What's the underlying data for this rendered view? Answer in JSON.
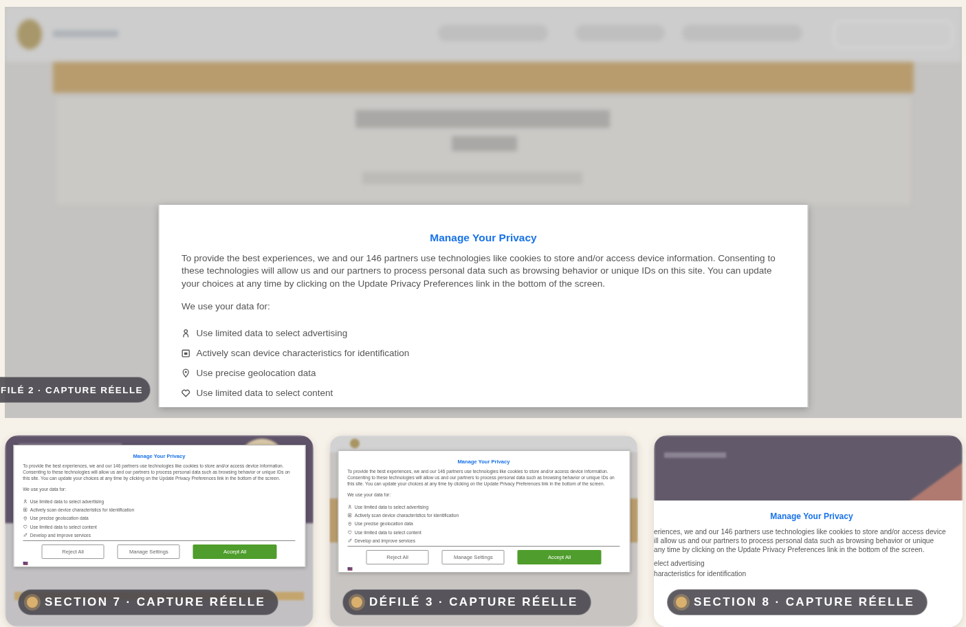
{
  "hero": {
    "caption": "FILÉ 2 · CAPTURE RÉELLE",
    "dialog": {
      "title": "Manage Your Privacy",
      "body": "To provide the best experiences, we and our 146 partners use technologies like cookies to store and/or access device information. Consenting to these technologies will allow us and our partners to process personal data such as browsing behavior or unique IDs on this site. You can update your choices at any time by clicking on the Update Privacy Preferences link in the bottom of the screen.",
      "intro": "We use your data for:",
      "purposes": [
        "Use limited data to select advertising",
        "Actively scan device characteristics for identification",
        "Use precise geolocation data",
        "Use limited data to select content"
      ]
    }
  },
  "cards": [
    {
      "kind": "dialog",
      "caption": "SECTION 7 · CAPTURE RÉELLE",
      "dialog": {
        "title": "Manage Your Privacy",
        "body": "To provide the best experiences, we and our 146 partners use technologies like cookies to store and/or access device information. Consenting to these technologies will allow us and our partners to process personal data such as browsing behavior or unique IDs on this site. You can update your choices at any time by clicking on the Update Privacy Preferences link in the bottom of the screen.",
        "intro": "We use your data for:",
        "purposes": [
          "Use limited data to select advertising",
          "Actively scan device characteristics for identification",
          "Use precise geolocation data",
          "Use limited data to select content",
          "Develop and improve services"
        ],
        "buttons": [
          {
            "label": "Reject All",
            "kind": "outline"
          },
          {
            "label": "Manage Settings",
            "kind": "outline"
          },
          {
            "label": "Accept All",
            "kind": "primary"
          }
        ]
      }
    },
    {
      "kind": "dialog",
      "caption": "DÉFILÉ 3 · CAPTURE RÉELLE",
      "dialog": {
        "title": "Manage Your Privacy",
        "body": "To provide the best experiences, we and our 146 partners use technologies like cookies to store and/or access device information. Consenting to these technologies will allow us and our partners to process personal data such as browsing behavior or unique IDs on this site. You can update your choices at any time by clicking on the Update Privacy Preferences link in the bottom of the screen.",
        "intro": "We use your data for:",
        "purposes": [
          "Use limited data to select advertising",
          "Actively scan device characteristics for identification",
          "Use precise geolocation data",
          "Use limited data to select content",
          "Develop and improve services"
        ],
        "buttons": [
          {
            "label": "Reject All",
            "kind": "outline"
          },
          {
            "label": "Manage Settings",
            "kind": "outline"
          },
          {
            "label": "Accept All",
            "kind": "primary"
          }
        ]
      }
    },
    {
      "kind": "sheet",
      "caption": "SECTION 8 · CAPTURE RÉELLE",
      "dialog": {
        "title": "Manage Your Privacy",
        "lines": [
          "eriences, we and our 146 partners use technologies like cookies to store and/or access device",
          "ill allow us and our partners to process personal data such as browsing behavior or unique",
          "any time by clicking on the Update Privacy Preferences link in the bottom of the screen."
        ],
        "purposes": [
          "elect advertising",
          "haracteristics for identification"
        ]
      }
    }
  ]
}
